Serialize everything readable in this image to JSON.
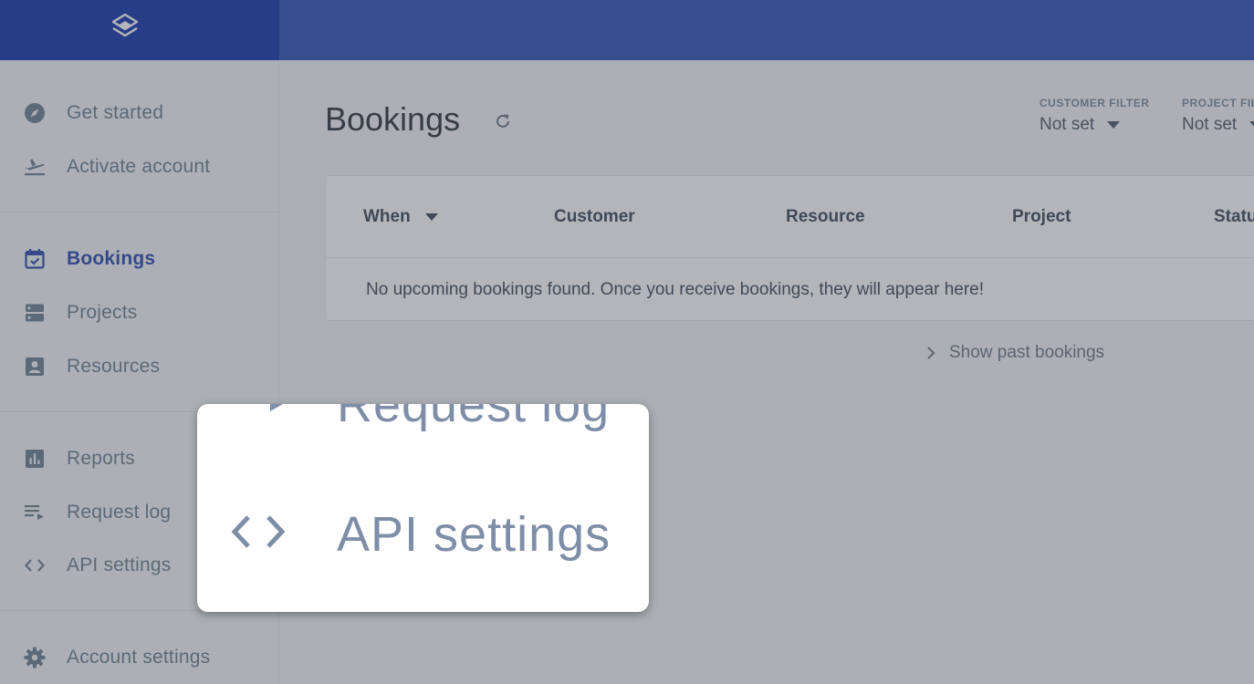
{
  "header": {
    "logo_icon": "stack-layers-icon"
  },
  "sidebar": {
    "items": [
      {
        "label": "Get started",
        "icon": "compass-icon"
      },
      {
        "label": "Activate account",
        "icon": "plane-takeoff-icon"
      },
      {
        "label": "Bookings",
        "icon": "calendar-check-icon",
        "active": true
      },
      {
        "label": "Projects",
        "icon": "server-icon"
      },
      {
        "label": "Resources",
        "icon": "contact-card-icon"
      },
      {
        "label": "Reports",
        "icon": "bar-chart-icon"
      },
      {
        "label": "Request log",
        "icon": "playlist-icon"
      },
      {
        "label": "API settings",
        "icon": "code-brackets-icon"
      },
      {
        "label": "Account settings",
        "icon": "gear-icon"
      }
    ]
  },
  "main": {
    "title": "Bookings",
    "filters": {
      "customer": {
        "label": "CUSTOMER FILTER",
        "value": "Not set"
      },
      "project": {
        "label": "PROJECT FILT",
        "value": "Not set"
      }
    },
    "table": {
      "columns": [
        "When",
        "Customer",
        "Resource",
        "Project",
        "Statu"
      ],
      "empty_message": "No upcoming bookings found. Once you receive bookings, they will appear here!"
    },
    "show_past_label": "Show past bookings"
  },
  "zoom_callout": {
    "partial_label": "Request log",
    "label": "API settings"
  },
  "colors": {
    "brand_dark": "#1230a5",
    "brand": "#2e4ab0",
    "active_text": "#2a44a8",
    "nav_text": "#6c7a8c"
  }
}
